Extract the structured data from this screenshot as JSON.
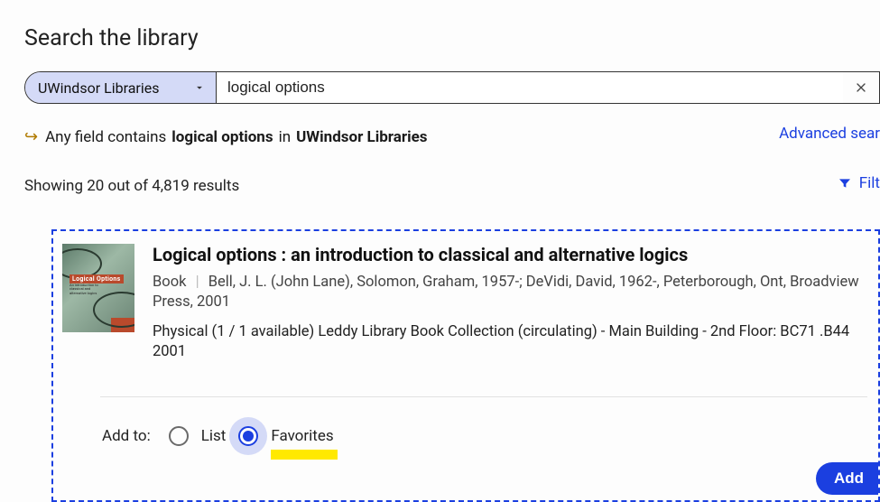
{
  "page": {
    "title": "Search the library"
  },
  "search": {
    "scope": "UWindsor Libraries",
    "query": "logical options"
  },
  "summary": {
    "prefix": "Any field contains",
    "term": "logical options",
    "in": "in",
    "scope": "UWindsor Libraries"
  },
  "links": {
    "advanced": "Advanced sear",
    "filter": "Filt"
  },
  "results": {
    "count_text": "Showing 20 out of 4,819 results"
  },
  "item": {
    "title": "Logical options : an introduction to classical and alternative logics",
    "type": "Book",
    "authors": "Bell, J. L. (John Lane), Solomon, Graham, 1957-; DeVidi, David, 1962-, Peterborough, Ont, Broadview Press, 2001",
    "availability": "Physical (1 / 1 available) Leddy Library Book Collection (circulating) - Main Building - 2nd Floor: BC71 .B44 2001",
    "thumb_label": "Logical Options",
    "thumb_sub": "An introduction to classical and alternative logics"
  },
  "addto": {
    "label": "Add to:",
    "list": "List",
    "favorites": "Favorites",
    "add_button": "Add"
  }
}
